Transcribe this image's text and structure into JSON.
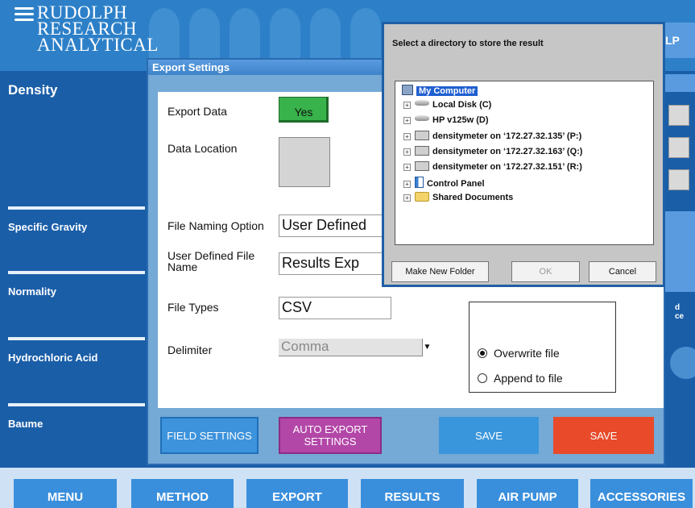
{
  "header": {
    "logo_line1": "RUDOLPH",
    "logo_line2": "RESEARCH",
    "logo_line3": "ANALYTICAL",
    "help_label": "LP"
  },
  "sidebar": {
    "items": [
      {
        "label": "Density"
      },
      {
        "label": "Specific Gravity"
      },
      {
        "label": "Normality"
      },
      {
        "label": "Hydrochloric Acid"
      },
      {
        "label": "Baume"
      }
    ]
  },
  "right_strip": {
    "partial_text_1": "d",
    "partial_text_2": "ce"
  },
  "bottom_nav": {
    "buttons": [
      {
        "label": "MENU"
      },
      {
        "label": "METHOD"
      },
      {
        "label": "EXPORT"
      },
      {
        "label": "RESULTS"
      },
      {
        "label": "AIR PUMP"
      },
      {
        "label": "ACCESSORIES"
      }
    ]
  },
  "export_settings": {
    "title": "Export Settings",
    "export_data_label": "Export Data",
    "export_data_value": "Yes",
    "data_location_label": "Data Location",
    "file_naming_label": "File Naming Option",
    "file_naming_value": "User Defined",
    "user_defined_label_1": "User Defined File",
    "user_defined_label_2": "Name",
    "user_defined_value": "Results Exp",
    "file_types_label": "File Types",
    "file_types_value": "CSV",
    "delimiter_label": "Delimiter",
    "delimiter_value": "Comma",
    "overwrite_label": "Overwrite file",
    "append_label": "Append to file",
    "overwrite_selected": true,
    "field_settings_label": "FIELD SETTINGS",
    "auto_export_label_1": "AUTO EXPORT",
    "auto_export_label_2": "SETTINGS",
    "save_label_1": "SAVE",
    "save_label_2": "SAVE"
  },
  "directory_dialog": {
    "title": "Select a directory to store the result",
    "tree": [
      {
        "label": "My Computer",
        "icon": "computer-icon",
        "selected": true
      },
      {
        "label": "Local Disk (C)",
        "icon": "disk-icon"
      },
      {
        "label": "HP v125w (D)",
        "icon": "disk-icon"
      },
      {
        "label": "densitymeter on ‘172.27.32.135’ (P:)",
        "icon": "network-drive-icon"
      },
      {
        "label": "densitymeter on ‘172.27.32.163’ (Q:)",
        "icon": "network-drive-icon"
      },
      {
        "label": "densitymeter on ‘172.27.32.151’ (R:)",
        "icon": "network-drive-icon"
      },
      {
        "label": "Control Panel",
        "icon": "control-panel-icon"
      },
      {
        "label": "Shared Documents",
        "icon": "folder-icon"
      }
    ],
    "expander_symbol": "+",
    "make_new_folder_label": "Make New Folder",
    "ok_label": "OK",
    "cancel_label": "Cancel"
  },
  "colors": {
    "background_blue": "#1a5ea8",
    "yes_green": "#38b24a",
    "auto_export_purple": "#b347a8",
    "save_red": "#e84a2a",
    "save_blue": "#3a96dc"
  }
}
